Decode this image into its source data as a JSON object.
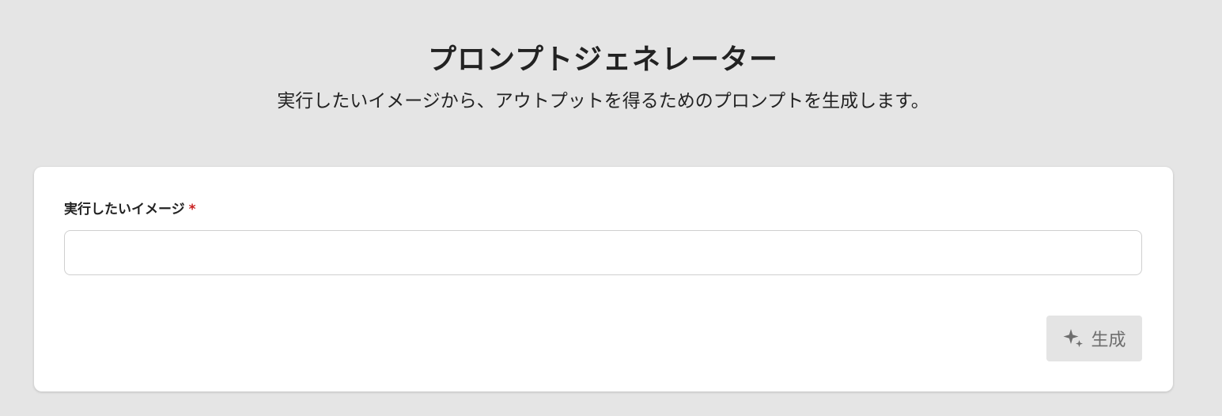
{
  "header": {
    "title": "プロンプトジェネレーター",
    "subtitle": "実行したいイメージから、アウトプットを得るためのプロンプトを生成します。"
  },
  "form": {
    "field_label": "実行したいイメージ",
    "required_mark": "*",
    "input_value": "",
    "input_placeholder": ""
  },
  "actions": {
    "generate_label": "生成",
    "generate_icon": "sparkle-icon"
  },
  "colors": {
    "page_background": "#e5e5e5",
    "card_background": "#ffffff",
    "required_red": "#c81e1e",
    "button_disabled_bg": "#e4e4e4",
    "button_disabled_text": "#6e6e6e"
  }
}
